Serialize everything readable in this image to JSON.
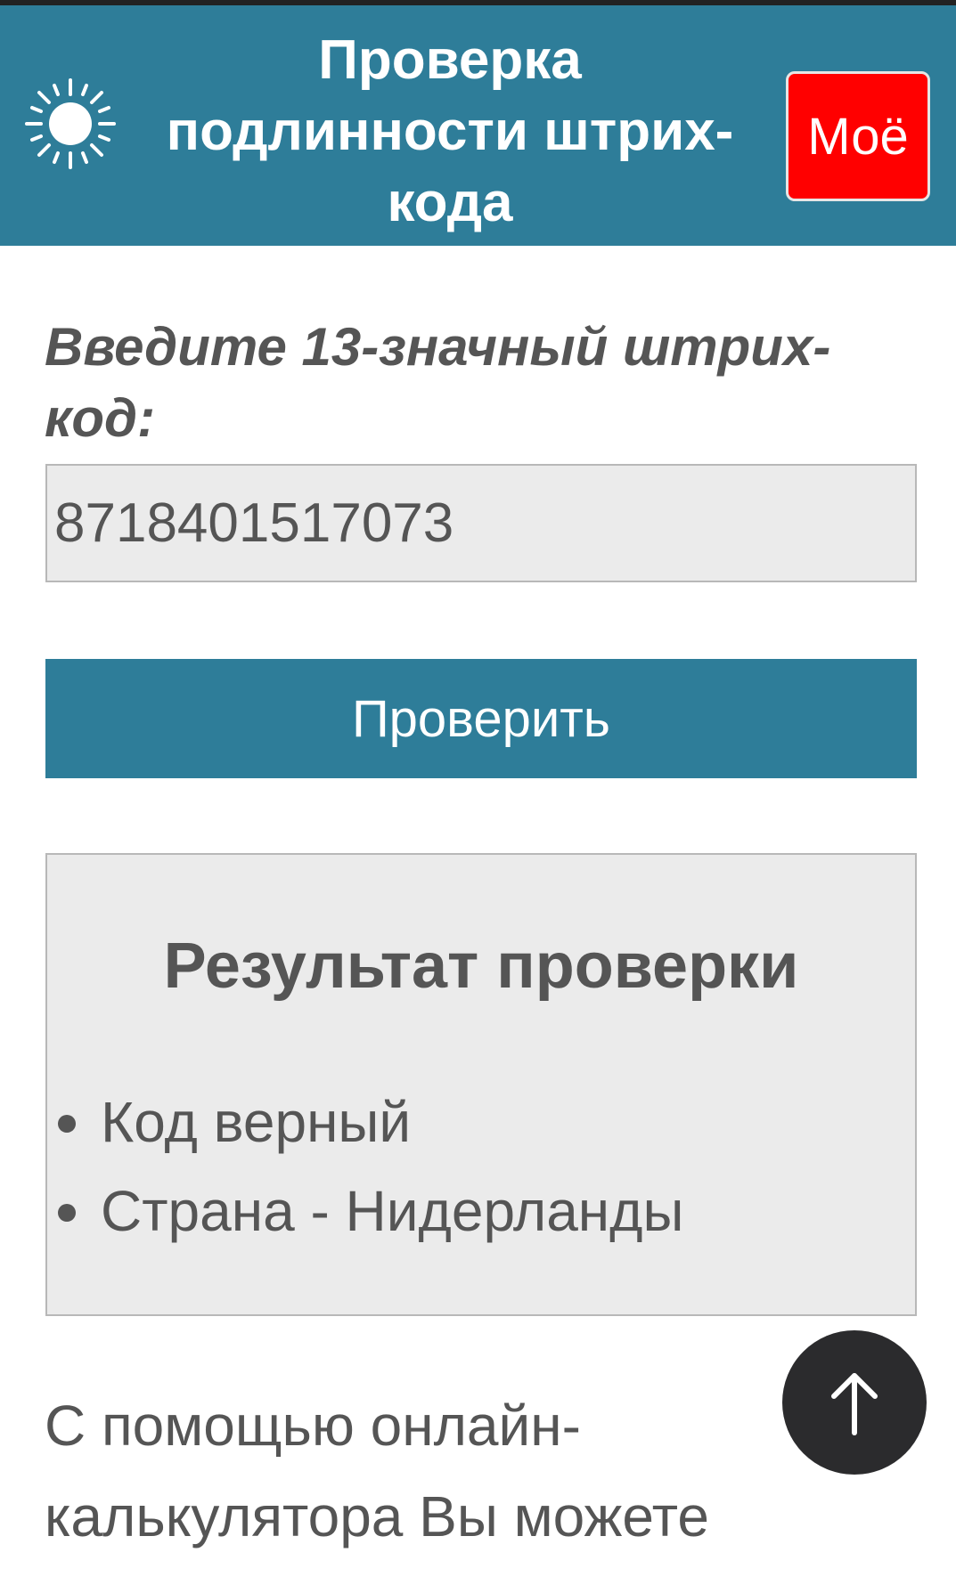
{
  "header": {
    "title": "Проверка подлинности штрих-кода",
    "my_button_label": "Моё",
    "theme_icon": "sun-icon"
  },
  "form": {
    "prompt": "Введите 13-значный штрих-код:",
    "barcode_value": "8718401517073",
    "check_button_label": "Проверить"
  },
  "result": {
    "title": "Результат проверки",
    "items": [
      "Код верный",
      "Страна - Нидерланды"
    ]
  },
  "description": {
    "text": "С помощью онлайн-калькулятора Вы можете"
  },
  "scroll_top": {
    "icon": "arrow-up-icon"
  },
  "colors": {
    "header_bg": "#2e7d99",
    "accent_button": "#ff0000",
    "panel_bg": "#ebebeb",
    "text": "#555555",
    "scroll_button_bg": "#2b2b2d"
  }
}
